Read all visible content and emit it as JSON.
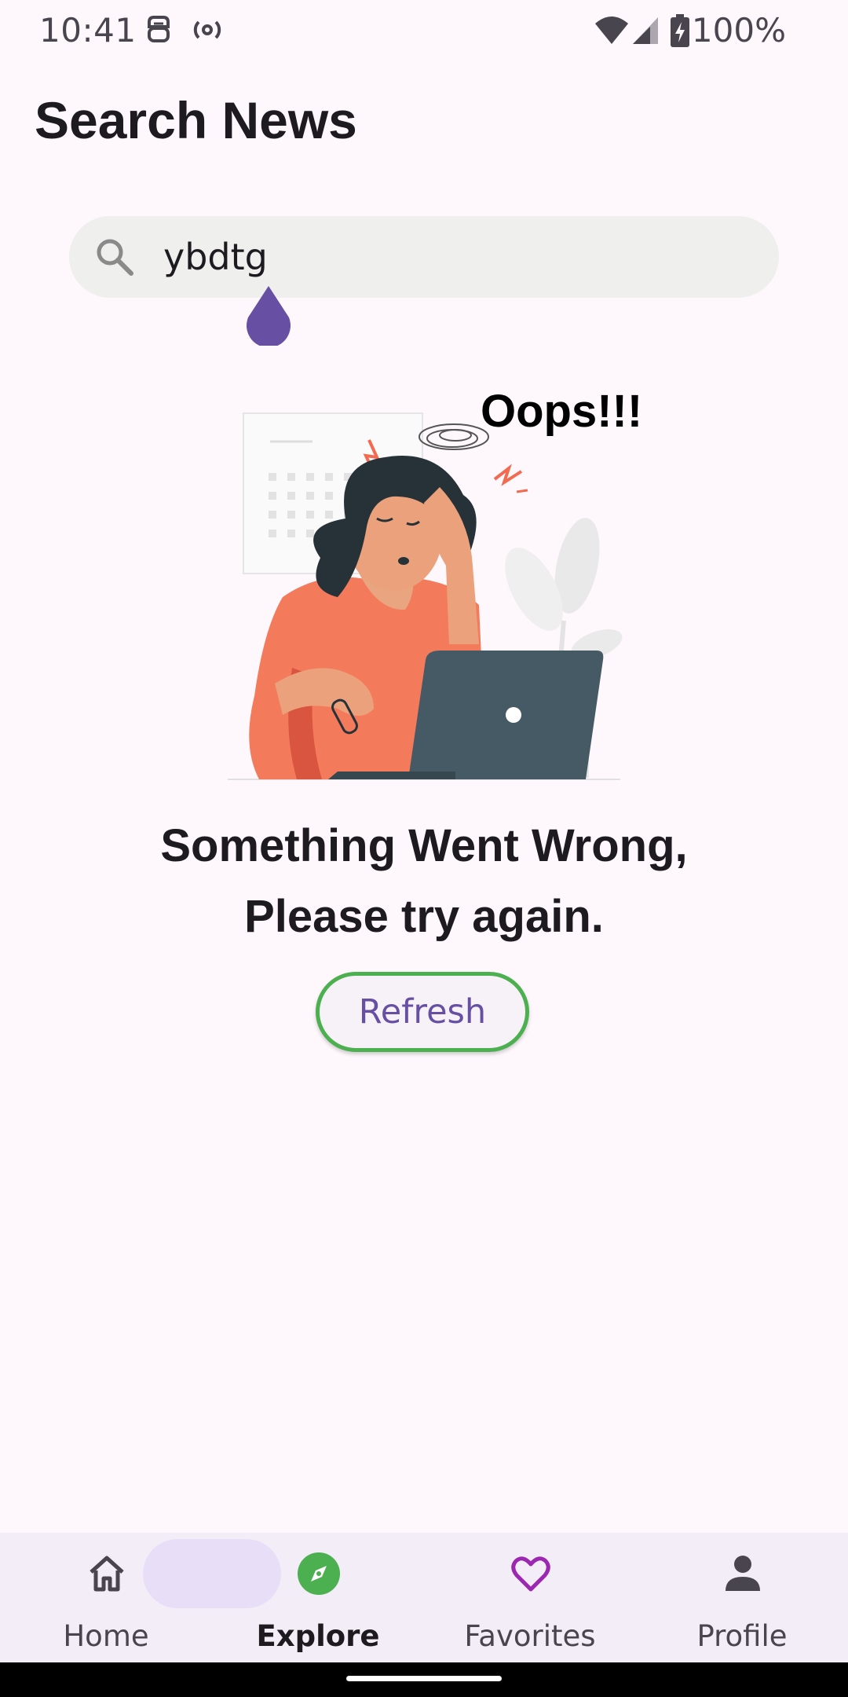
{
  "status_bar": {
    "time": "10:41",
    "battery": "100%",
    "icons": [
      "assistant-icon",
      "hotspot-icon",
      "wifi-icon",
      "signal-icon",
      "battery-charging-icon"
    ]
  },
  "page": {
    "title": "Search News"
  },
  "search": {
    "value": "ybdtg",
    "icon": "search-icon"
  },
  "illustration": {
    "caption": "Oops!!!"
  },
  "error": {
    "line1": "Something Went Wrong,",
    "line2": "Please try again."
  },
  "refresh": {
    "label": "Refresh",
    "border_color": "#4CAF50",
    "text_color": "#6750A4"
  },
  "bottom_nav": {
    "items": [
      {
        "label": "Home",
        "icon": "home-icon",
        "active": false
      },
      {
        "label": "Explore",
        "icon": "compass-icon",
        "active": true
      },
      {
        "label": "Favorites",
        "icon": "heart-icon",
        "active": false
      },
      {
        "label": "Profile",
        "icon": "person-icon",
        "active": false
      }
    ]
  },
  "colors": {
    "background": "#FEF7FC",
    "accent": "#6750A4",
    "explore_icon": "#4CAF50",
    "favorites_icon": "#9C27B0"
  }
}
